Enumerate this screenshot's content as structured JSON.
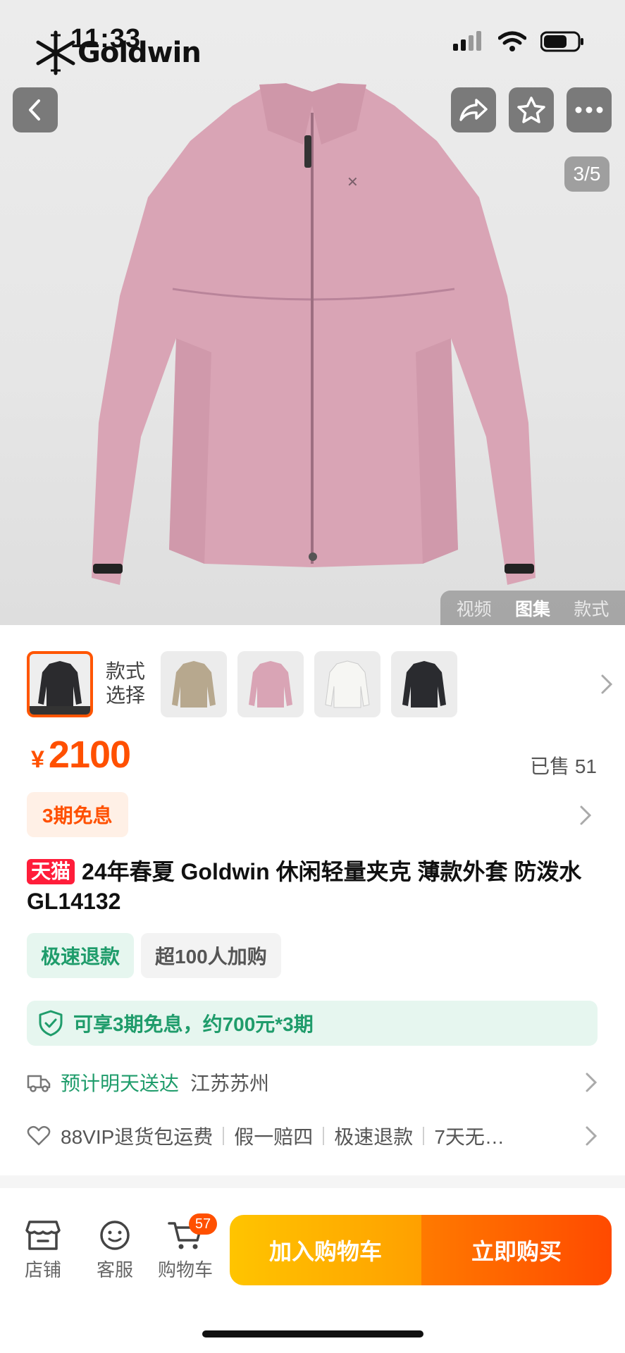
{
  "status_bar": {
    "time": "11:33",
    "brand": "Goldwin"
  },
  "gallery": {
    "indicator": "3/5",
    "tabs": [
      "视频",
      "图集",
      "款式"
    ],
    "active_tab": "图集",
    "product_color": "#d9a4b5"
  },
  "variants": {
    "label": "款式\n选择",
    "colors": [
      "#2b2b2e",
      "#b7a88e",
      "#d9a4b5",
      "#ececea",
      "#2a2b2f"
    ]
  },
  "price": {
    "currency": "¥",
    "amount": "2100",
    "sold": "已售 51"
  },
  "installment": {
    "label": "3期免息"
  },
  "title": {
    "badge": "天猫",
    "text": "24年春夏 Goldwin 休闲轻量夹克 薄款外套  防泼水 GL14132"
  },
  "tags": [
    "极速退款",
    "超100人加购"
  ],
  "promise": {
    "text": "可享3期免息，约700元*3期"
  },
  "delivery": {
    "eta": "预计明天送达",
    "location": "江苏苏州"
  },
  "services": [
    "88VIP退货包运费",
    "假一赔四",
    "极速退款",
    "7天无…"
  ],
  "bottom_bar": {
    "shop": "店铺",
    "service": "客服",
    "cart": "购物车",
    "cart_count": "57",
    "add_to_cart": "加入购物车",
    "buy_now": "立即购买"
  },
  "colors": {
    "accent": "#ff5000",
    "green": "#1f9c6b",
    "tmall_red": "#ff1d3a"
  }
}
